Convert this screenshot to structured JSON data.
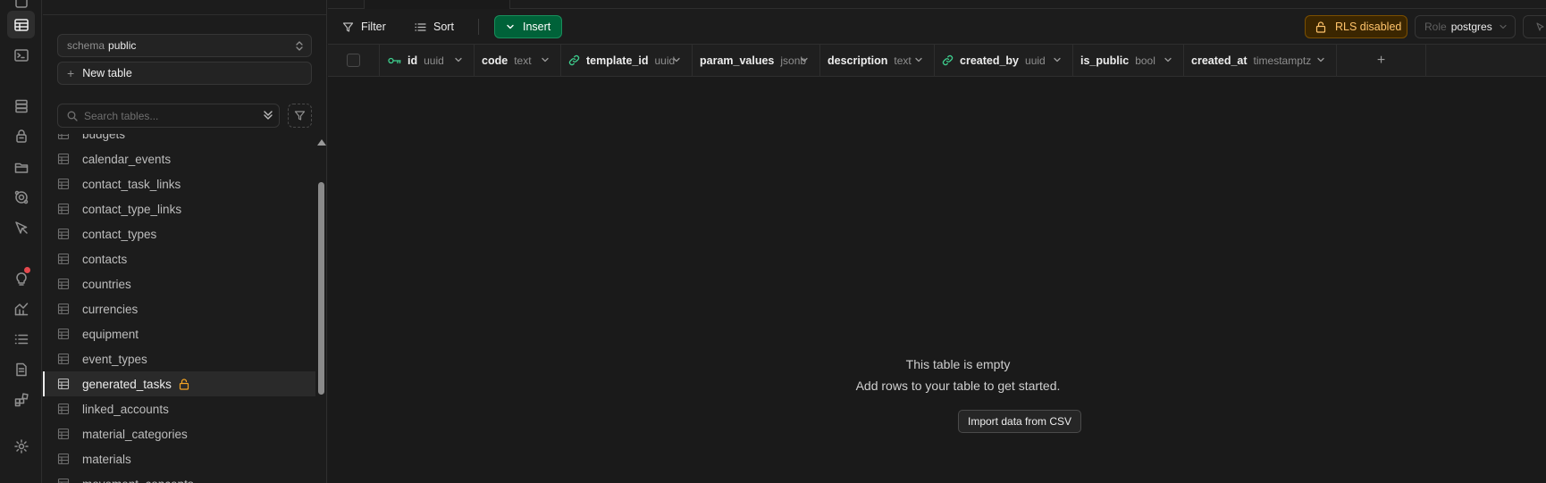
{
  "rail": {
    "icons": [
      "home-icon",
      "table-editor-icon",
      "sql-editor-icon",
      "database-icon",
      "auth-icon",
      "storage-icon",
      "edge-functions-icon",
      "realtime-icon",
      "advisors-icon",
      "reports-icon",
      "logs-icon",
      "api-docs-icon",
      "integrations-icon",
      "settings-icon"
    ]
  },
  "sidebar": {
    "schema_label": "schema",
    "schema_value": "public",
    "new_table_label": "New table",
    "search_placeholder": "Search tables...",
    "tables": [
      {
        "name": "budgets"
      },
      {
        "name": "calendar_events"
      },
      {
        "name": "contact_task_links"
      },
      {
        "name": "contact_type_links"
      },
      {
        "name": "contact_types"
      },
      {
        "name": "contacts"
      },
      {
        "name": "countries"
      },
      {
        "name": "currencies"
      },
      {
        "name": "equipment"
      },
      {
        "name": "event_types"
      },
      {
        "name": "generated_tasks",
        "active": true,
        "locked": true
      },
      {
        "name": "linked_accounts"
      },
      {
        "name": "material_categories"
      },
      {
        "name": "materials"
      },
      {
        "name": "movement_concepts"
      }
    ]
  },
  "toolbar": {
    "filter_label": "Filter",
    "sort_label": "Sort",
    "insert_label": "Insert",
    "rls_label": "RLS disabled",
    "role_label": "Role",
    "role_value": "postgres"
  },
  "columns": [
    {
      "name": "id",
      "type": "uuid",
      "key": "primary"
    },
    {
      "name": "code",
      "type": "text"
    },
    {
      "name": "template_id",
      "type": "uuid",
      "key": "foreign"
    },
    {
      "name": "param_values",
      "type": "jsonb"
    },
    {
      "name": "description",
      "type": "text"
    },
    {
      "name": "created_by",
      "type": "uuid",
      "key": "foreign"
    },
    {
      "name": "is_public",
      "type": "bool"
    },
    {
      "name": "created_at",
      "type": "timestamptz"
    }
  ],
  "empty_state": {
    "title": "This table is empty",
    "subtitle": "Add rows to your table to get started.",
    "import_label": "Import data from CSV"
  },
  "colors": {
    "insert_bg": "#006239",
    "rls_bg": "#3b2600",
    "rls_text": "#ffc46b",
    "key_icon": "#3ecf8e"
  }
}
